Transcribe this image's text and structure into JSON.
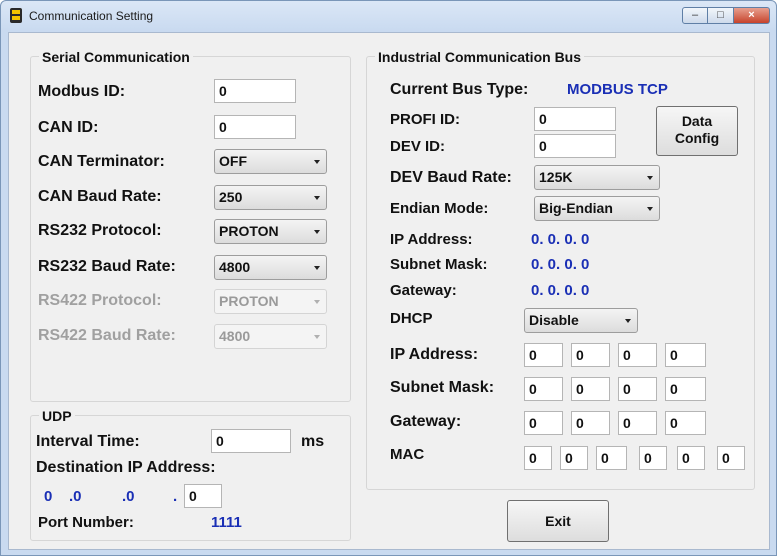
{
  "window": {
    "title": "Communication Setting",
    "min_icon": "minimize-icon",
    "max_icon": "maximize-icon",
    "close_icon": "close-icon"
  },
  "serial": {
    "group_label": "Serial Communication",
    "modbus_id": {
      "label": "Modbus ID:",
      "value": "0"
    },
    "can_id": {
      "label": "CAN ID:",
      "value": "0"
    },
    "can_terminator": {
      "label": "CAN Terminator:",
      "value": "OFF"
    },
    "can_baud_rate": {
      "label": "CAN Baud Rate:",
      "value": "250"
    },
    "rs232_protocol": {
      "label": "RS232 Protocol:",
      "value": "PROTON"
    },
    "rs232_baud_rate": {
      "label": "RS232 Baud Rate:",
      "value": "4800"
    },
    "rs422_protocol": {
      "label": "RS422 Protocol:",
      "value": "PROTON"
    },
    "rs422_baud_rate": {
      "label": "RS422 Baud Rate:",
      "value": "4800"
    }
  },
  "udp": {
    "group_label": "UDP",
    "interval": {
      "label": "Interval Time:",
      "value": "0",
      "unit": "ms"
    },
    "dest_ip_label": "Destination IP Address:",
    "dest_ip": [
      "0",
      ".0",
      ".0",
      "."
    ],
    "dest_ip_last": "0",
    "port": {
      "label": "Port Number:",
      "value": "1111"
    }
  },
  "industrial": {
    "group_label": "Industrial Communication Bus",
    "bus_type": {
      "label": "Current Bus Type:",
      "value": "MODBUS TCP"
    },
    "profi_id": {
      "label": "PROFI ID:",
      "value": "0"
    },
    "dev_id": {
      "label": "DEV ID:",
      "value": "0"
    },
    "data_config": [
      "Data",
      "Config"
    ],
    "dev_baud_rate": {
      "label": "DEV Baud Rate:",
      "value": "125K"
    },
    "endian_mode": {
      "label": "Endian Mode:",
      "value": "Big-Endian"
    },
    "ip_address_ro": {
      "label": "IP Address:",
      "value": "0. 0. 0. 0"
    },
    "subnet_mask_ro": {
      "label": "Subnet Mask:",
      "value": "0. 0. 0. 0"
    },
    "gateway_ro": {
      "label": "Gateway:",
      "value": "0. 0. 0. 0"
    },
    "dhcp": {
      "label": "DHCP",
      "value": "Disable"
    },
    "ip_address": {
      "label": "IP Address:",
      "octets": [
        "0",
        "0",
        "0",
        "0"
      ]
    },
    "subnet_mask": {
      "label": "Subnet Mask:",
      "octets": [
        "0",
        "0",
        "0",
        "0"
      ]
    },
    "gateway": {
      "label": "Gateway:",
      "octets": [
        "0",
        "0",
        "0",
        "0"
      ]
    },
    "mac": {
      "label": "MAC",
      "octets": [
        "0",
        "0",
        "0",
        "0",
        "0",
        "0"
      ]
    }
  },
  "exit_label": "Exit"
}
